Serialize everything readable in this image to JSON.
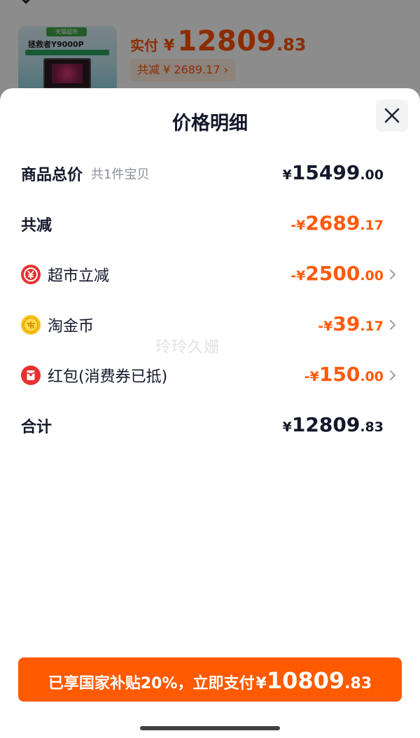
{
  "background": {
    "header": "",
    "thumbnail": {
      "badge": "天猫超市",
      "model": "拯救者Y9000P"
    },
    "price_label": "实付",
    "price_currency": "¥",
    "price_int": "12809",
    "price_dec": ".83",
    "discount_text": "共减 ¥ 2689.17 ›"
  },
  "sheet": {
    "title": "价格明细",
    "close_icon": "close-icon",
    "rows": [
      {
        "label": "商品总价",
        "sub": "共1件宝贝",
        "currency": "¥",
        "int": "15499",
        "dec": ".00",
        "color": "dark",
        "bold": true
      },
      {
        "label": "共减",
        "currency": "-¥",
        "int": "2689",
        "dec": ".17",
        "color": "orange",
        "bold": true
      },
      {
        "label": "超市立减",
        "icon": "supermarket-discount-icon",
        "currency": "-¥",
        "int": "2500",
        "dec": ".00",
        "color": "orange",
        "arrow": true
      },
      {
        "label": "淘金币",
        "icon": "gold-coin-icon",
        "currency": "-¥",
        "int": "39",
        "dec": ".17",
        "color": "orange",
        "arrow": true
      },
      {
        "label": "红包(消费券已抵)",
        "icon": "red-envelope-icon",
        "currency": "-¥",
        "int": "150",
        "dec": ".00",
        "color": "orange",
        "arrow": true
      },
      {
        "label": "合计",
        "currency": "¥",
        "int": "12809",
        "dec": ".83",
        "color": "dark",
        "bold": true
      }
    ],
    "watermark": "玲玲久姗"
  },
  "pay_button": {
    "text": "已享国家补贴20%，立即支付",
    "currency": "¥",
    "int": "10809",
    "dec": ".83"
  },
  "colors": {
    "accent": "#ff5a00",
    "price_orange": "#ff5a0a",
    "text_dark": "#14182a",
    "sub_gray": "#8a8f9a"
  }
}
